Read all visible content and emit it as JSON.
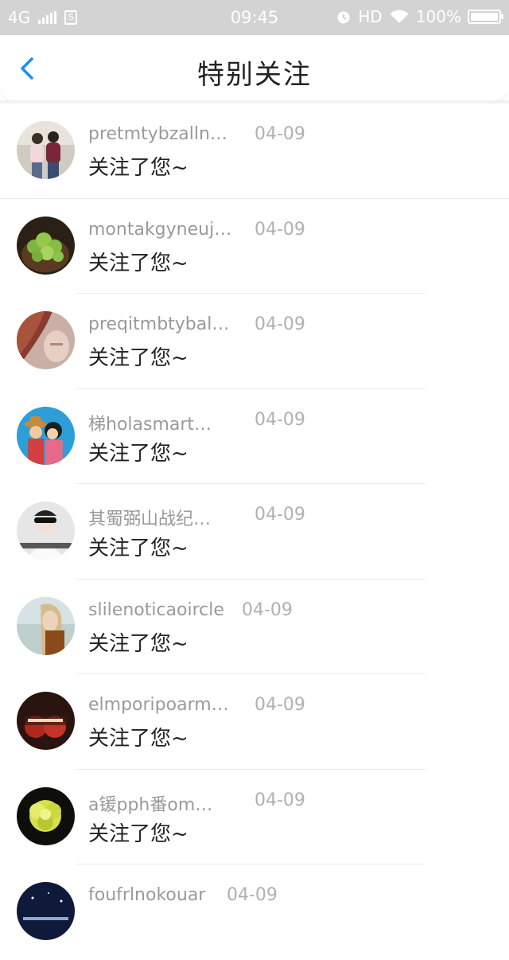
{
  "status_bar": {
    "network": "4G",
    "time": "09:45",
    "hd": "HD",
    "battery": "100%",
    "battery_level": 1.0
  },
  "header": {
    "title": "特别关注",
    "back_icon": "chevron-left-icon"
  },
  "accent_color": "#1a8cff",
  "items": [
    {
      "name": "pretmtybzalln…",
      "date": "04-09",
      "message": "关注了您~"
    },
    {
      "name": "montakgyneuj…",
      "date": "04-09",
      "message": "关注了您~"
    },
    {
      "name": "preqitmbtybal…",
      "date": "04-09",
      "message": "关注了您~"
    },
    {
      "name": "梯holasmart…",
      "date": "04-09",
      "message": "关注了您~"
    },
    {
      "name": "其蜀弼山战纪…",
      "date": "04-09",
      "message": "关注了您~"
    },
    {
      "name": "slilenoticaoircle",
      "date": "04-09",
      "message": "关注了您~"
    },
    {
      "name": "elmporipoarm…",
      "date": "04-09",
      "message": "关注了您~"
    },
    {
      "name": "a锾pph番om…",
      "date": "04-09",
      "message": "关注了您~"
    },
    {
      "name": "foufrlnokouar",
      "date": "04-09",
      "message": ""
    }
  ]
}
